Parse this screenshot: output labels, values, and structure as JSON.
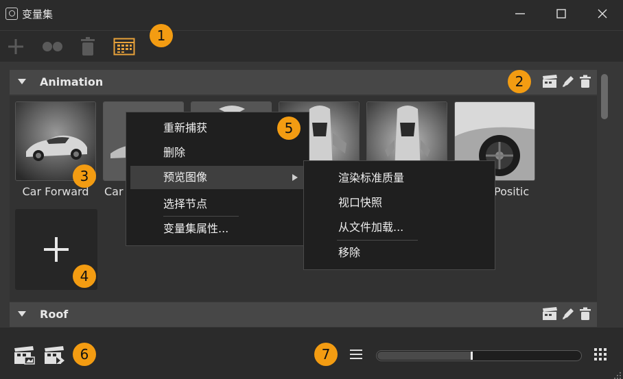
{
  "window": {
    "title": "变量集"
  },
  "toolbar": {
    "add_icon": "plus-icon",
    "link_icon": "dots-icon",
    "delete_icon": "trash-icon",
    "view_icon": "table-icon"
  },
  "groups": [
    {
      "name": "Animation",
      "thumbnails": [
        {
          "label": "Car Forward"
        },
        {
          "label": "Car"
        },
        {
          "label": ""
        },
        {
          "label": ""
        },
        {
          "label": ""
        },
        {
          "label": "Positic"
        }
      ]
    },
    {
      "name": "Roof"
    }
  ],
  "context_menu": {
    "items": [
      "重新捕获",
      "删除",
      "预览图像",
      "选择节点",
      "变量集属性..."
    ]
  },
  "submenu": {
    "items": [
      "渲染标准质量",
      "视口快照",
      "从文件加载...",
      "移除"
    ]
  },
  "badges": [
    "1",
    "2",
    "3",
    "4",
    "5",
    "6",
    "7"
  ],
  "bottombar": {
    "slider_value": 0.46
  },
  "colors": {
    "accent": "#f39c12",
    "panel": "#373737",
    "menu_bg": "#1f1f1f"
  }
}
